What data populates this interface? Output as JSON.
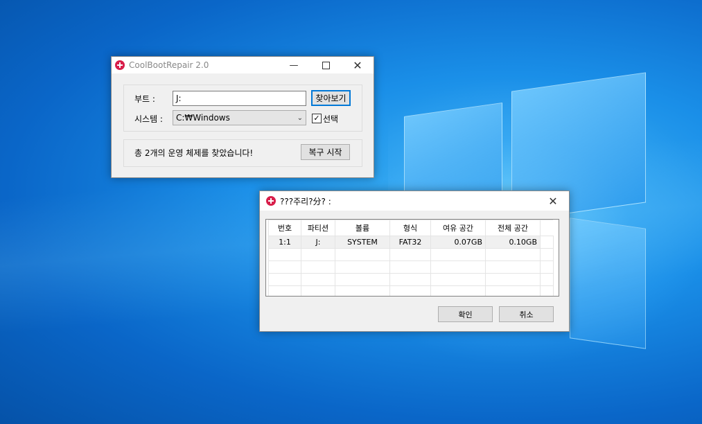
{
  "window1": {
    "title": "CoolBootRepair 2.0",
    "boot_label": "부트 :",
    "boot_value": "J:",
    "browse_label": "찾아보기",
    "system_label": "시스템 :",
    "system_value": "C:₩Windows",
    "select_label": "선택",
    "select_checked": true,
    "status_text": "총 2개의 운영 체제를 찾았습니다!",
    "repair_label": "복구 시작"
  },
  "window2": {
    "title": "???주리?分? :",
    "columns": [
      "번호",
      "파티션",
      "볼륨",
      "형식",
      "여유 공간",
      "전체 공간"
    ],
    "rows": [
      [
        "1:1",
        "J:",
        "SYSTEM",
        "FAT32",
        "0.07GB",
        "0.10GB"
      ]
    ],
    "ok_label": "확인",
    "cancel_label": "취소"
  },
  "icons": {
    "app": "red-cross-icon",
    "minimize": "minimize-icon",
    "maximize": "maximize-icon",
    "close": "close-icon"
  }
}
